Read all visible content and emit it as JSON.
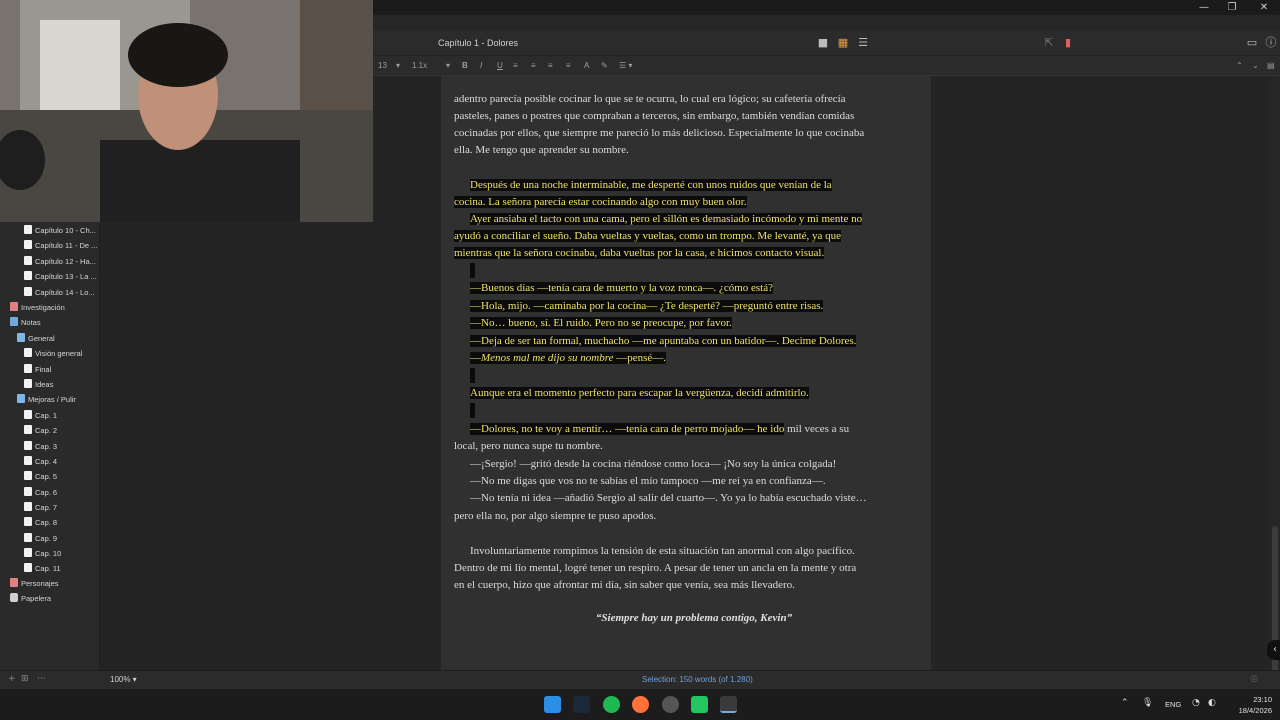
{
  "window": {
    "minimize": "—",
    "restore": "❐",
    "close": "✕"
  },
  "header": {
    "title": "Capítulo 1 - Dolores"
  },
  "toolbar": {
    "font_size": "13",
    "line_spacing": "1.1x",
    "bold": "B",
    "italic": "I",
    "underline": "U"
  },
  "sidebar": {
    "items": [
      {
        "label": "Capítulo 10 - Ch..."
      },
      {
        "label": "Capítulo 11 - De ..."
      },
      {
        "label": "Capítulo 12 - Ha..."
      },
      {
        "label": "Capítulo 13 - La ..."
      },
      {
        "label": "Capítulo 14 - Lo..."
      },
      {
        "label": "Investigación"
      },
      {
        "label": "Notas"
      },
      {
        "label": "General"
      },
      {
        "label": "Visión general"
      },
      {
        "label": "Final"
      },
      {
        "label": "Ideas"
      },
      {
        "label": "Mejoras / Pulir"
      },
      {
        "label": "Cap. 1"
      },
      {
        "label": "Cap. 2"
      },
      {
        "label": "Cap. 3"
      },
      {
        "label": "Cap. 4"
      },
      {
        "label": "Cap. 5"
      },
      {
        "label": "Cap. 6"
      },
      {
        "label": "Cap. 7"
      },
      {
        "label": "Cap. 8"
      },
      {
        "label": "Cap. 9"
      },
      {
        "label": "Cap. 10"
      },
      {
        "label": "Cap. 11"
      },
      {
        "label": "Personajes"
      },
      {
        "label": "Papelera"
      }
    ]
  },
  "document": {
    "lines": [
      "adentro parecía posible cocinar lo que se te ocurra, lo cual era lógico; su cafetería ofrecía",
      "pasteles, panes o postres que compraban a terceros, sin embargo, también vendían comidas",
      "cocinadas por ellos, que siempre me pareció lo más delicioso. Especialmente lo que cocinaba",
      "ella. Me tengo que aprender su nombre.",
      "Después de una noche interminable, me desperté con unos ruidos que venían de la",
      "cocina. La señora parecía estar cocinando algo con muy buen olor.",
      "Ayer ansiaba el tacto con una cama, pero el sillón es demasiado incómodo y mi mente no",
      "ayudó a conciliar el sueño. Daba vueltas y vueltas, como un trompo. Me levanté, ya que",
      "mientras que la señora cocinaba, daba vueltas por la casa, e hicimos contacto visual.",
      "—Buenos días —tenía cara de muerto y la voz ronca—. ¿cómo está?",
      "—Hola, mijo. —caminaba por la cocina— ¿Te desperté? —preguntó entre risas.",
      "—No… bueno, sí. El ruido. Pero no se preocupe, por favor.",
      "—Deja de ser tan formal, muchacho —me apuntaba con un batidor—. Decime Dolores.",
      "Menos mal me dijo su nombre",
      " —pensé—.",
      "—",
      "Aunque era el momento perfecto para escapar la vergüenza, decidí admitirlo.",
      "—Dolores, no te voy a mentir… —tenía cara de perro mojado— he ido",
      " mil veces a su",
      "local, pero nunca supe tu nombre.",
      "—¡Sergio! —gritó desde la cocina riéndose como loca— ¡No soy la única colgada!",
      "—No me digas que vos no te sabías el mío tampoco —me reí ya en confianza—.",
      "—No tenía ni idea —añadió Sergio al salir del cuarto—. Yo ya lo había escuchado viste…",
      "pero ella no, por algo siempre te puso apodos.",
      "Involuntariamente rompimos la tensión de esta situación tan anormal con algo pacífico.",
      "Dentro de mi lío mental, logré tener un respiro. A pesar de tener un ancla en la mente y otra",
      "en el cuerpo, hizo que afrontar mi día, sin saber que venía, sea más llevadero."
    ],
    "quote": "“Siempre hay un problema contigo, Kevin”"
  },
  "status": {
    "zoom": "100% ▾",
    "selection": "Selection: 150 words (of 1.280)"
  },
  "tray": {
    "lang": "ENG",
    "time": "23:10",
    "date": "18/4/2026"
  },
  "colors": {
    "highlight_bg": "#0b0b0b",
    "highlight_text": "#f0e26a",
    "selection_text": "#6fa0d8"
  }
}
